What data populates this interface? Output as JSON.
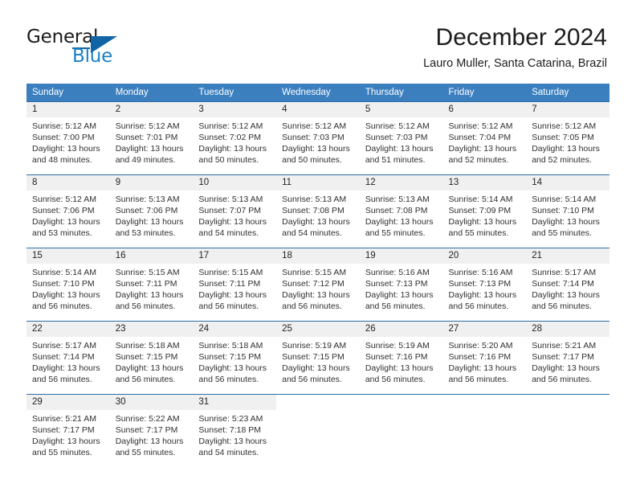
{
  "brand": {
    "name_part1": "General",
    "name_part2": "Blue",
    "logo_icon": "triangle-logo-icon"
  },
  "header": {
    "month_title": "December 2024",
    "location": "Lauro Muller, Santa Catarina, Brazil"
  },
  "theme": {
    "header_blue": "#3b7fbf",
    "separator_blue": "#2f6ea5",
    "daynum_strip_gray": "#f0f0f0",
    "brand_blue": "#1c7fc4",
    "logo_blue": "#1164a6",
    "text_dark": "#303030"
  },
  "calendar": {
    "weekday_headers": [
      "Sunday",
      "Monday",
      "Tuesday",
      "Wednesday",
      "Thursday",
      "Friday",
      "Saturday"
    ],
    "weeks": [
      [
        {
          "day": "1",
          "sunrise": "Sunrise: 5:12 AM",
          "sunset": "Sunset: 7:00 PM",
          "daylight1": "Daylight: 13 hours",
          "daylight2": "and 48 minutes."
        },
        {
          "day": "2",
          "sunrise": "Sunrise: 5:12 AM",
          "sunset": "Sunset: 7:01 PM",
          "daylight1": "Daylight: 13 hours",
          "daylight2": "and 49 minutes."
        },
        {
          "day": "3",
          "sunrise": "Sunrise: 5:12 AM",
          "sunset": "Sunset: 7:02 PM",
          "daylight1": "Daylight: 13 hours",
          "daylight2": "and 50 minutes."
        },
        {
          "day": "4",
          "sunrise": "Sunrise: 5:12 AM",
          "sunset": "Sunset: 7:03 PM",
          "daylight1": "Daylight: 13 hours",
          "daylight2": "and 50 minutes."
        },
        {
          "day": "5",
          "sunrise": "Sunrise: 5:12 AM",
          "sunset": "Sunset: 7:03 PM",
          "daylight1": "Daylight: 13 hours",
          "daylight2": "and 51 minutes."
        },
        {
          "day": "6",
          "sunrise": "Sunrise: 5:12 AM",
          "sunset": "Sunset: 7:04 PM",
          "daylight1": "Daylight: 13 hours",
          "daylight2": "and 52 minutes."
        },
        {
          "day": "7",
          "sunrise": "Sunrise: 5:12 AM",
          "sunset": "Sunset: 7:05 PM",
          "daylight1": "Daylight: 13 hours",
          "daylight2": "and 52 minutes."
        }
      ],
      [
        {
          "day": "8",
          "sunrise": "Sunrise: 5:12 AM",
          "sunset": "Sunset: 7:06 PM",
          "daylight1": "Daylight: 13 hours",
          "daylight2": "and 53 minutes."
        },
        {
          "day": "9",
          "sunrise": "Sunrise: 5:13 AM",
          "sunset": "Sunset: 7:06 PM",
          "daylight1": "Daylight: 13 hours",
          "daylight2": "and 53 minutes."
        },
        {
          "day": "10",
          "sunrise": "Sunrise: 5:13 AM",
          "sunset": "Sunset: 7:07 PM",
          "daylight1": "Daylight: 13 hours",
          "daylight2": "and 54 minutes."
        },
        {
          "day": "11",
          "sunrise": "Sunrise: 5:13 AM",
          "sunset": "Sunset: 7:08 PM",
          "daylight1": "Daylight: 13 hours",
          "daylight2": "and 54 minutes."
        },
        {
          "day": "12",
          "sunrise": "Sunrise: 5:13 AM",
          "sunset": "Sunset: 7:08 PM",
          "daylight1": "Daylight: 13 hours",
          "daylight2": "and 55 minutes."
        },
        {
          "day": "13",
          "sunrise": "Sunrise: 5:14 AM",
          "sunset": "Sunset: 7:09 PM",
          "daylight1": "Daylight: 13 hours",
          "daylight2": "and 55 minutes."
        },
        {
          "day": "14",
          "sunrise": "Sunrise: 5:14 AM",
          "sunset": "Sunset: 7:10 PM",
          "daylight1": "Daylight: 13 hours",
          "daylight2": "and 55 minutes."
        }
      ],
      [
        {
          "day": "15",
          "sunrise": "Sunrise: 5:14 AM",
          "sunset": "Sunset: 7:10 PM",
          "daylight1": "Daylight: 13 hours",
          "daylight2": "and 56 minutes."
        },
        {
          "day": "16",
          "sunrise": "Sunrise: 5:15 AM",
          "sunset": "Sunset: 7:11 PM",
          "daylight1": "Daylight: 13 hours",
          "daylight2": "and 56 minutes."
        },
        {
          "day": "17",
          "sunrise": "Sunrise: 5:15 AM",
          "sunset": "Sunset: 7:11 PM",
          "daylight1": "Daylight: 13 hours",
          "daylight2": "and 56 minutes."
        },
        {
          "day": "18",
          "sunrise": "Sunrise: 5:15 AM",
          "sunset": "Sunset: 7:12 PM",
          "daylight1": "Daylight: 13 hours",
          "daylight2": "and 56 minutes."
        },
        {
          "day": "19",
          "sunrise": "Sunrise: 5:16 AM",
          "sunset": "Sunset: 7:13 PM",
          "daylight1": "Daylight: 13 hours",
          "daylight2": "and 56 minutes."
        },
        {
          "day": "20",
          "sunrise": "Sunrise: 5:16 AM",
          "sunset": "Sunset: 7:13 PM",
          "daylight1": "Daylight: 13 hours",
          "daylight2": "and 56 minutes."
        },
        {
          "day": "21",
          "sunrise": "Sunrise: 5:17 AM",
          "sunset": "Sunset: 7:14 PM",
          "daylight1": "Daylight: 13 hours",
          "daylight2": "and 56 minutes."
        }
      ],
      [
        {
          "day": "22",
          "sunrise": "Sunrise: 5:17 AM",
          "sunset": "Sunset: 7:14 PM",
          "daylight1": "Daylight: 13 hours",
          "daylight2": "and 56 minutes."
        },
        {
          "day": "23",
          "sunrise": "Sunrise: 5:18 AM",
          "sunset": "Sunset: 7:15 PM",
          "daylight1": "Daylight: 13 hours",
          "daylight2": "and 56 minutes."
        },
        {
          "day": "24",
          "sunrise": "Sunrise: 5:18 AM",
          "sunset": "Sunset: 7:15 PM",
          "daylight1": "Daylight: 13 hours",
          "daylight2": "and 56 minutes."
        },
        {
          "day": "25",
          "sunrise": "Sunrise: 5:19 AM",
          "sunset": "Sunset: 7:15 PM",
          "daylight1": "Daylight: 13 hours",
          "daylight2": "and 56 minutes."
        },
        {
          "day": "26",
          "sunrise": "Sunrise: 5:19 AM",
          "sunset": "Sunset: 7:16 PM",
          "daylight1": "Daylight: 13 hours",
          "daylight2": "and 56 minutes."
        },
        {
          "day": "27",
          "sunrise": "Sunrise: 5:20 AM",
          "sunset": "Sunset: 7:16 PM",
          "daylight1": "Daylight: 13 hours",
          "daylight2": "and 56 minutes."
        },
        {
          "day": "28",
          "sunrise": "Sunrise: 5:21 AM",
          "sunset": "Sunset: 7:17 PM",
          "daylight1": "Daylight: 13 hours",
          "daylight2": "and 56 minutes."
        }
      ],
      [
        {
          "day": "29",
          "sunrise": "Sunrise: 5:21 AM",
          "sunset": "Sunset: 7:17 PM",
          "daylight1": "Daylight: 13 hours",
          "daylight2": "and 55 minutes."
        },
        {
          "day": "30",
          "sunrise": "Sunrise: 5:22 AM",
          "sunset": "Sunset: 7:17 PM",
          "daylight1": "Daylight: 13 hours",
          "daylight2": "and 55 minutes."
        },
        {
          "day": "31",
          "sunrise": "Sunrise: 5:23 AM",
          "sunset": "Sunset: 7:18 PM",
          "daylight1": "Daylight: 13 hours",
          "daylight2": "and 54 minutes."
        },
        {
          "day": "",
          "sunrise": "",
          "sunset": "",
          "daylight1": "",
          "daylight2": ""
        },
        {
          "day": "",
          "sunrise": "",
          "sunset": "",
          "daylight1": "",
          "daylight2": ""
        },
        {
          "day": "",
          "sunrise": "",
          "sunset": "",
          "daylight1": "",
          "daylight2": ""
        },
        {
          "day": "",
          "sunrise": "",
          "sunset": "",
          "daylight1": "",
          "daylight2": ""
        }
      ]
    ]
  }
}
